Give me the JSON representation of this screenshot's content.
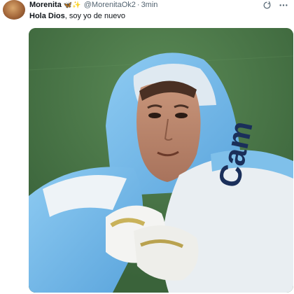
{
  "post": {
    "author_name": "Morenita",
    "name_emojis": "🦋✨",
    "handle": "@MorenitaOk2",
    "separator": "·",
    "time": "3min",
    "text_bold": "Hola Dios",
    "text_rest": ", soy yo de nuevo"
  },
  "media": {
    "jersey_text": "Cam"
  },
  "icons": {
    "action_1": "refresh-icon",
    "action_2": "more-icon"
  },
  "colors": {
    "handle_gray": "#536471",
    "flag_blue": "#6fb6e8",
    "field_green": "#4e7d4c"
  }
}
